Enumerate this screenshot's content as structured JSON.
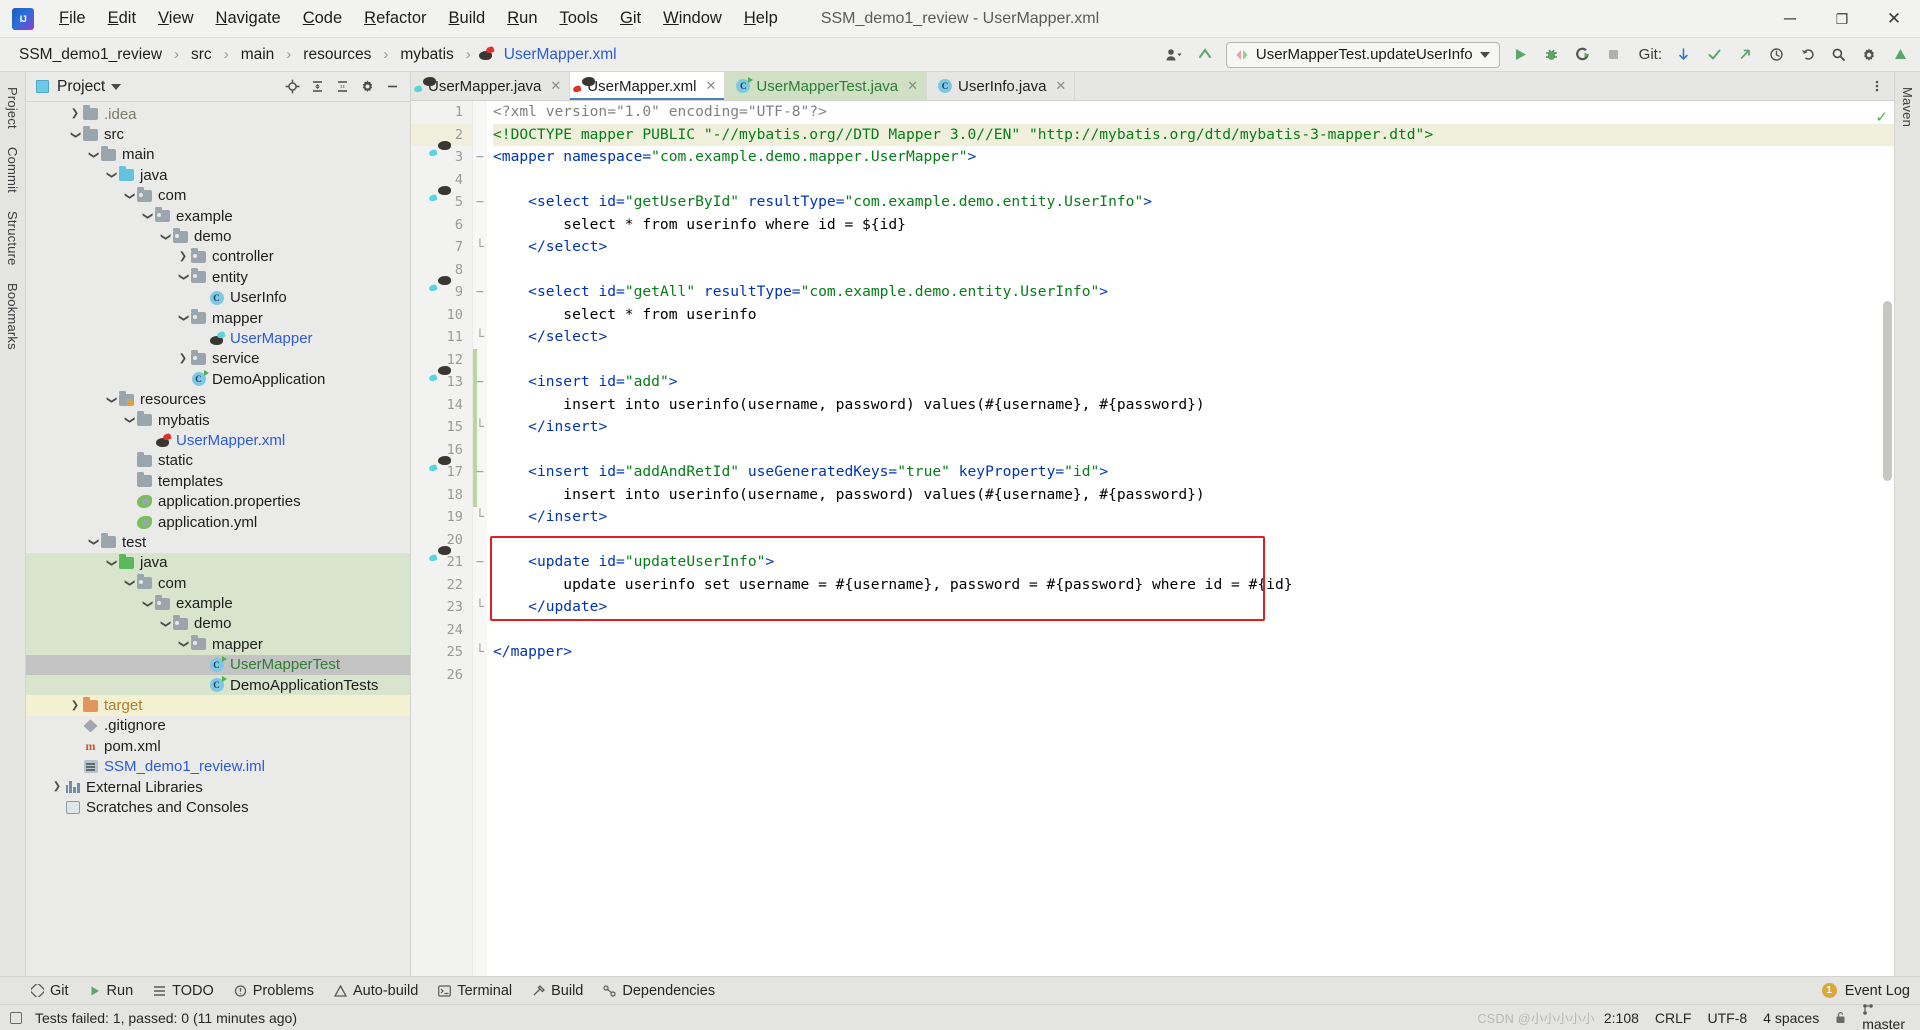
{
  "window": {
    "title": "SSM_demo1_review - UserMapper.xml",
    "minimize": "─",
    "maximize": "❐",
    "close": "✕"
  },
  "menubar": [
    {
      "label": "File",
      "mnemonic": "F"
    },
    {
      "label": "Edit",
      "mnemonic": "E"
    },
    {
      "label": "View",
      "mnemonic": "V"
    },
    {
      "label": "Navigate",
      "mnemonic": "N"
    },
    {
      "label": "Code",
      "mnemonic": "C"
    },
    {
      "label": "Refactor",
      "mnemonic": "R"
    },
    {
      "label": "Build",
      "mnemonic": "B"
    },
    {
      "label": "Run",
      "mnemonic": "R"
    },
    {
      "label": "Tools",
      "mnemonic": "T"
    },
    {
      "label": "Git",
      "mnemonic": "G"
    },
    {
      "label": "Window",
      "mnemonic": "W"
    },
    {
      "label": "Help",
      "mnemonic": "H"
    }
  ],
  "breadcrumb": {
    "items": [
      "SSM_demo1_review",
      "src",
      "main",
      "resources",
      "mybatis",
      "UserMapper.xml"
    ],
    "separator": "›",
    "file_icon": "mybatis-file-icon",
    "link_color": "#2b5bd7"
  },
  "toolbar": {
    "user_icon": "user-account-icon",
    "updates_icon": "update-arrow-icon",
    "run_config": "UserMapperTest.updateUserInfo",
    "run_config_icon": "run-config-icon",
    "run_icon": "run-play-icon",
    "debug_icon": "debug-bug-icon",
    "coverage_icon": "run-with-coverage-icon",
    "stop_icon": "stop-icon",
    "git_label": "Git:",
    "git_update_icon": "git-update-icon",
    "git_commit_icon": "git-commit-icon",
    "git_push_icon": "git-push-icon",
    "history_icon": "history-clock-icon",
    "undo_icon": "undo-icon",
    "search_icon": "search-icon",
    "settings_icon": "gear-icon",
    "ide_icon": "ide-badge-icon"
  },
  "left_rail": [
    "Project",
    "Commit",
    "Structure",
    "Bookmarks"
  ],
  "right_rail": [
    "Maven"
  ],
  "project_panel": {
    "title": "Project",
    "dropdown_icon": "chevron-down-icon",
    "actions": [
      "locate-icon",
      "expand-all-icon",
      "collapse-all-icon",
      "settings-icon",
      "hide-icon"
    ],
    "tree": [
      {
        "label": ".idea",
        "depth": 2,
        "arrow": "collapsed",
        "icon": "folder",
        "style": "gray"
      },
      {
        "label": "src",
        "depth": 2,
        "arrow": "expanded",
        "icon": "folder"
      },
      {
        "label": "main",
        "depth": 3,
        "arrow": "expanded",
        "icon": "folder"
      },
      {
        "label": "java",
        "depth": 4,
        "arrow": "expanded",
        "icon": "folder-source"
      },
      {
        "label": "com",
        "depth": 5,
        "arrow": "expanded",
        "icon": "folder-package"
      },
      {
        "label": "example",
        "depth": 6,
        "arrow": "expanded",
        "icon": "folder-package"
      },
      {
        "label": "demo",
        "depth": 7,
        "arrow": "expanded",
        "icon": "folder-package"
      },
      {
        "label": "controller",
        "depth": 8,
        "arrow": "collapsed",
        "icon": "folder-package"
      },
      {
        "label": "entity",
        "depth": 8,
        "arrow": "expanded",
        "icon": "folder-package"
      },
      {
        "label": "UserInfo",
        "depth": 9,
        "arrow": "none",
        "icon": "class"
      },
      {
        "label": "mapper",
        "depth": 8,
        "arrow": "expanded",
        "icon": "folder-package"
      },
      {
        "label": "UserMapper",
        "depth": 9,
        "arrow": "none",
        "icon": "mybatis",
        "style": "blue"
      },
      {
        "label": "service",
        "depth": 8,
        "arrow": "collapsed",
        "icon": "folder-package"
      },
      {
        "label": "DemoApplication",
        "depth": 8,
        "arrow": "none",
        "icon": "class-run"
      },
      {
        "label": "resources",
        "depth": 4,
        "arrow": "expanded",
        "icon": "folder-resource"
      },
      {
        "label": "mybatis",
        "depth": 5,
        "arrow": "expanded",
        "icon": "folder"
      },
      {
        "label": "UserMapper.xml",
        "depth": 6,
        "arrow": "none",
        "icon": "mybatis-red",
        "style": "blue"
      },
      {
        "label": "static",
        "depth": 5,
        "arrow": "none",
        "icon": "folder"
      },
      {
        "label": "templates",
        "depth": 5,
        "arrow": "none",
        "icon": "folder"
      },
      {
        "label": "application.properties",
        "depth": 5,
        "arrow": "none",
        "icon": "spring"
      },
      {
        "label": "application.yml",
        "depth": 5,
        "arrow": "none",
        "icon": "spring"
      },
      {
        "label": "test",
        "depth": 3,
        "arrow": "expanded",
        "icon": "folder"
      },
      {
        "label": "java",
        "depth": 4,
        "arrow": "expanded",
        "icon": "folder-test",
        "row": "green"
      },
      {
        "label": "com",
        "depth": 5,
        "arrow": "expanded",
        "icon": "folder-package",
        "row": "green"
      },
      {
        "label": "example",
        "depth": 6,
        "arrow": "expanded",
        "icon": "folder-package",
        "row": "green"
      },
      {
        "label": "demo",
        "depth": 7,
        "arrow": "expanded",
        "icon": "folder-package",
        "row": "green"
      },
      {
        "label": "mapper",
        "depth": 8,
        "arrow": "expanded",
        "icon": "folder-package",
        "row": "green"
      },
      {
        "label": "UserMapperTest",
        "depth": 9,
        "arrow": "none",
        "icon": "class-run",
        "style": "green",
        "row": "sel"
      },
      {
        "label": "DemoApplicationTests",
        "depth": 9,
        "arrow": "none",
        "icon": "class-run",
        "row": "green"
      },
      {
        "label": "target",
        "depth": 2,
        "arrow": "collapsed",
        "icon": "folder-target",
        "style": "orange",
        "row": "yellow"
      },
      {
        "label": ".gitignore",
        "depth": 2,
        "arrow": "none",
        "icon": "gitignore"
      },
      {
        "label": "pom.xml",
        "depth": 2,
        "arrow": "none",
        "icon": "maven"
      },
      {
        "label": "SSM_demo1_review.iml",
        "depth": 2,
        "arrow": "none",
        "icon": "iml",
        "style": "blue"
      },
      {
        "label": "External Libraries",
        "depth": 1,
        "arrow": "collapsed",
        "icon": "libraries"
      },
      {
        "label": "Scratches and Consoles",
        "depth": 1,
        "arrow": "none",
        "icon": "scratches"
      }
    ]
  },
  "editor": {
    "tabs": [
      {
        "label": "UserMapper.java",
        "icon": "mybatis-file-icon",
        "state": "normal"
      },
      {
        "label": "UserMapper.xml",
        "icon": "mybatis-red-icon",
        "state": "active-file"
      },
      {
        "label": "UserMapperTest.java",
        "icon": "test-class-icon",
        "state": "active-run"
      },
      {
        "label": "UserInfo.java",
        "icon": "class-icon",
        "state": "normal"
      }
    ],
    "more_icon": "more-vertical-icon",
    "inspection_ok_icon": "inspection-ok-check",
    "highlight_box_color": "#e02020",
    "lines": [
      {
        "n": 1,
        "current": false,
        "gutter": null,
        "tokens": [
          {
            "c": "pi",
            "x": "<?xml version=\"1.0\" encoding=\"UTF-8\"?>"
          }
        ]
      },
      {
        "n": 2,
        "current": true,
        "gutter": null,
        "tokens": [
          {
            "c": "dt",
            "x": "<!DOCTYPE mapper PUBLIC \"-//mybatis.org//DTD Mapper 3.0//EN\" \"http://mybatis.org/dtd/mybatis-3-mapper.dtd\">"
          }
        ]
      },
      {
        "n": 3,
        "current": false,
        "gutter": "mybatis",
        "fold": "−",
        "tokens": [
          {
            "c": "t",
            "x": "<mapper "
          },
          {
            "c": "a",
            "x": "namespace="
          },
          {
            "c": "s",
            "x": "\"com.example.demo.mapper.UserMapper\""
          },
          {
            "c": "t",
            "x": ">"
          }
        ]
      },
      {
        "n": 4,
        "current": false,
        "gutter": null,
        "tokens": [
          {
            "c": "p",
            "x": ""
          }
        ]
      },
      {
        "n": 5,
        "current": false,
        "gutter": "mybatis",
        "fold": "−",
        "tokens": [
          {
            "c": "p",
            "x": "    "
          },
          {
            "c": "t",
            "x": "<select "
          },
          {
            "c": "a",
            "x": "id="
          },
          {
            "c": "s",
            "x": "\"getUserById\""
          },
          {
            "c": "p",
            "x": " "
          },
          {
            "c": "a",
            "x": "resultType="
          },
          {
            "c": "s",
            "x": "\"com.example.demo.entity.UserInfo\""
          },
          {
            "c": "t",
            "x": ">"
          }
        ]
      },
      {
        "n": 6,
        "current": false,
        "gutter": null,
        "tokens": [
          {
            "c": "p",
            "x": "        select * from userinfo where id = ${id}"
          }
        ]
      },
      {
        "n": 7,
        "current": false,
        "gutter": null,
        "fold": "└",
        "tokens": [
          {
            "c": "p",
            "x": "    "
          },
          {
            "c": "t",
            "x": "</select>"
          }
        ]
      },
      {
        "n": 8,
        "current": false,
        "gutter": null,
        "tokens": [
          {
            "c": "p",
            "x": ""
          }
        ]
      },
      {
        "n": 9,
        "current": false,
        "gutter": "mybatis",
        "fold": "−",
        "tokens": [
          {
            "c": "p",
            "x": "    "
          },
          {
            "c": "t",
            "x": "<select "
          },
          {
            "c": "a",
            "x": "id="
          },
          {
            "c": "s",
            "x": "\"getAll\""
          },
          {
            "c": "p",
            "x": " "
          },
          {
            "c": "a",
            "x": "resultType="
          },
          {
            "c": "s",
            "x": "\"com.example.demo.entity.UserInfo\""
          },
          {
            "c": "t",
            "x": ">"
          }
        ]
      },
      {
        "n": 10,
        "current": false,
        "gutter": null,
        "tokens": [
          {
            "c": "p",
            "x": "        select * from userinfo"
          }
        ]
      },
      {
        "n": 11,
        "current": false,
        "gutter": null,
        "fold": "└",
        "tokens": [
          {
            "c": "p",
            "x": "    "
          },
          {
            "c": "t",
            "x": "</select>"
          }
        ]
      },
      {
        "n": 12,
        "current": false,
        "gutter": null,
        "tokens": [
          {
            "c": "p",
            "x": ""
          }
        ]
      },
      {
        "n": 13,
        "current": false,
        "gutter": "mybatis",
        "fold": "−",
        "tokens": [
          {
            "c": "p",
            "x": "    "
          },
          {
            "c": "t",
            "x": "<insert "
          },
          {
            "c": "a",
            "x": "id="
          },
          {
            "c": "s",
            "x": "\"add\""
          },
          {
            "c": "t",
            "x": ">"
          }
        ]
      },
      {
        "n": 14,
        "current": false,
        "gutter": null,
        "tokens": [
          {
            "c": "p",
            "x": "        insert into userinfo(username, password) values(#{username}, #{password})"
          }
        ]
      },
      {
        "n": 15,
        "current": false,
        "gutter": null,
        "fold": "└",
        "tokens": [
          {
            "c": "p",
            "x": "    "
          },
          {
            "c": "t",
            "x": "</insert>"
          }
        ]
      },
      {
        "n": 16,
        "current": false,
        "gutter": null,
        "tokens": [
          {
            "c": "p",
            "x": ""
          }
        ]
      },
      {
        "n": 17,
        "current": false,
        "gutter": "mybatis",
        "fold": "−",
        "tokens": [
          {
            "c": "p",
            "x": "    "
          },
          {
            "c": "t",
            "x": "<insert "
          },
          {
            "c": "a",
            "x": "id="
          },
          {
            "c": "s",
            "x": "\"addAndRetId\""
          },
          {
            "c": "p",
            "x": " "
          },
          {
            "c": "a",
            "x": "useGeneratedKeys="
          },
          {
            "c": "s",
            "x": "\"true\""
          },
          {
            "c": "p",
            "x": " "
          },
          {
            "c": "a",
            "x": "keyProperty="
          },
          {
            "c": "s",
            "x": "\"id\""
          },
          {
            "c": "t",
            "x": ">"
          }
        ]
      },
      {
        "n": 18,
        "current": false,
        "gutter": null,
        "tokens": [
          {
            "c": "p",
            "x": "        insert into userinfo(username, password) values(#{username}, #{password})"
          }
        ]
      },
      {
        "n": 19,
        "current": false,
        "gutter": null,
        "fold": "└",
        "tokens": [
          {
            "c": "p",
            "x": "    "
          },
          {
            "c": "t",
            "x": "</insert>"
          }
        ]
      },
      {
        "n": 20,
        "current": false,
        "gutter": null,
        "tokens": [
          {
            "c": "p",
            "x": ""
          }
        ]
      },
      {
        "n": 21,
        "current": false,
        "gutter": "mybatis",
        "fold": "−",
        "tokens": [
          {
            "c": "p",
            "x": "    "
          },
          {
            "c": "t",
            "x": "<update "
          },
          {
            "c": "a",
            "x": "id="
          },
          {
            "c": "s",
            "x": "\"updateUserInfo\""
          },
          {
            "c": "t",
            "x": ">"
          }
        ]
      },
      {
        "n": 22,
        "current": false,
        "gutter": null,
        "tokens": [
          {
            "c": "p",
            "x": "        update userinfo set username = #{username}, password = #{password} where id = #{id}"
          }
        ]
      },
      {
        "n": 23,
        "current": false,
        "gutter": null,
        "fold": "└",
        "tokens": [
          {
            "c": "p",
            "x": "    "
          },
          {
            "c": "t",
            "x": "</update>"
          }
        ]
      },
      {
        "n": 24,
        "current": false,
        "gutter": null,
        "tokens": [
          {
            "c": "p",
            "x": ""
          }
        ]
      },
      {
        "n": 25,
        "current": false,
        "gutter": null,
        "fold": "└",
        "tokens": [
          {
            "c": "t",
            "x": "</mapper>"
          }
        ]
      },
      {
        "n": 26,
        "current": false,
        "gutter": null,
        "tokens": [
          {
            "c": "p",
            "x": ""
          }
        ]
      }
    ]
  },
  "bottom_bar": {
    "windows": [
      {
        "label": "Git",
        "icon": "git-icon"
      },
      {
        "label": "Run",
        "icon": "run-play-icon"
      },
      {
        "label": "TODO",
        "icon": "todo-icon"
      },
      {
        "label": "Problems",
        "icon": "problems-icon"
      },
      {
        "label": "Auto-build",
        "icon": "auto-build-icon"
      },
      {
        "label": "Terminal",
        "icon": "terminal-icon"
      },
      {
        "label": "Build",
        "icon": "build-hammer-icon"
      },
      {
        "label": "Dependencies",
        "icon": "dependencies-icon"
      }
    ],
    "event_log": {
      "label": "Event Log",
      "count": "1",
      "icon": "event-log-icon"
    }
  },
  "statusbar": {
    "message": "Tests failed: 1, passed: 0 (11 minutes ago)",
    "message_icon": "test-status-icon",
    "caret": "2:108",
    "line_ending": "CRLF",
    "encoding": "UTF-8",
    "indent": "4 spaces",
    "branch": "master",
    "branch_icon": "git-branch-icon",
    "lock_icon": "read-write-lock-icon",
    "watermark": "CSDN @小小小小小"
  }
}
